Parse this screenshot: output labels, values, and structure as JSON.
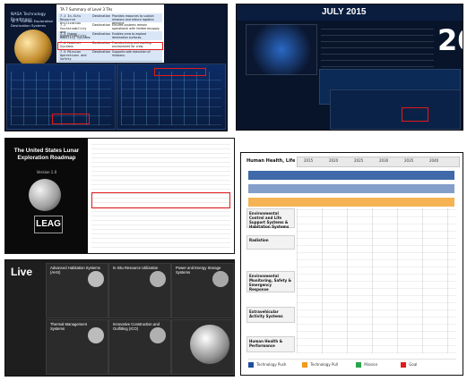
{
  "panel_top_left": {
    "title": "NASA Technology Roadmaps",
    "subtitle": "TA 7: Human Exploration Destination Systems",
    "table_title": "TA 7 Summary of Level 3 TAs",
    "rows": [
      {
        "c1": "7.1 In-Situ Resource Utilization",
        "c2": "Destination",
        "c3": "Provides resources to sustain missions and reduce logistics demand."
      },
      {
        "c1": "7.2 Sustainability and Supportability",
        "c2": "Destination",
        "c3": "Ensures systems remain operational with limited resupply."
      },
      {
        "c1": "7.3 Human Mobility Systems",
        "c2": "Destination",
        "c3": "Enables crew to explore destination surfaces."
      },
      {
        "c1": "7.4 Habitat Systems",
        "c2": "Destination",
        "c3": "Provides living and working environment for crew."
      },
      {
        "c1": "7.5 Mission Operations and Safety",
        "c2": "Destination",
        "c3": "Supports safe execution of missions."
      }
    ]
  },
  "panel_top_right": {
    "header": "JULY 2015",
    "big_digits": "20"
  },
  "panel_mid_left": {
    "title": "The United States Lunar Exploration Roadmap",
    "subtitle": "Version 1.0",
    "logo": "LEAG"
  },
  "panel_bottom_left": {
    "title": "Live",
    "tiles": [
      {
        "name": "Advanced Habitation Systems (AHS)"
      },
      {
        "name": "In Situ Resource Utilization"
      },
      {
        "name": "Power and Energy Storage Systems"
      },
      {
        "name": "Thermal Management Systems"
      },
      {
        "name": "Innovative Construction and Outfitting (ICO)"
      },
      {
        "name": ""
      }
    ]
  },
  "panel_right": {
    "title": "Human Health, Life Support, & Habitation Systems",
    "years": [
      "2015",
      "2020",
      "2025",
      "2030",
      "2035",
      "2040"
    ],
    "sections": [
      "Environmental Control and Life Support Systems & Habitation Systems",
      "Radiation",
      "Environmental Monitoring, Safety & Emergency Response",
      "Extravehicular Activity Systems",
      "Human Health & Performance"
    ],
    "legend": [
      "Technology Push",
      "Technology Pull",
      "Mission",
      "Goal"
    ]
  },
  "colors": {
    "accent_red": "#e21b1b",
    "dark_blue": "#0b1730",
    "mid_blue": "#1d4f9a",
    "orange": "#f29a1a"
  }
}
